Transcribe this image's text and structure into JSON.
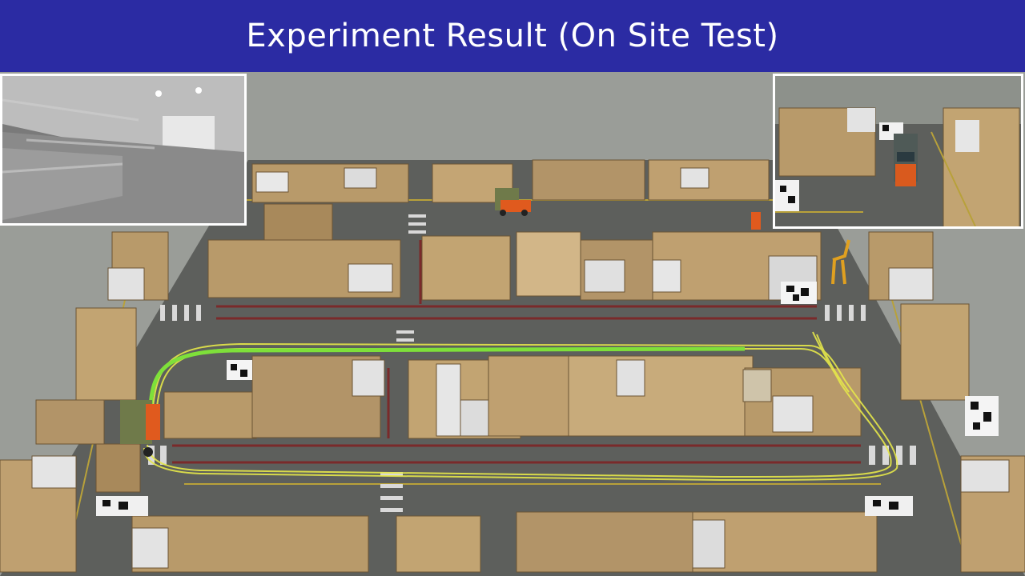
{
  "title": "Experiment Result (On Site Test)",
  "colors": {
    "banner": "#2b2ba3",
    "title_text": "#ffffff",
    "floor": "#5d5f5c",
    "background": "#9a9d98",
    "trajectory_reference": "#7ee03a",
    "trajectory_run": "#e6e84a",
    "forklift": "#e05a1e",
    "aisle_line": "#7a2a2a"
  },
  "panels": {
    "left": "onboard-camera-view",
    "right": "top-down-tracking-view"
  },
  "icons": [
    "forklift-icon",
    "qr-marker-icon",
    "pallet-rack-icon",
    "pallet-jack-icon"
  ]
}
